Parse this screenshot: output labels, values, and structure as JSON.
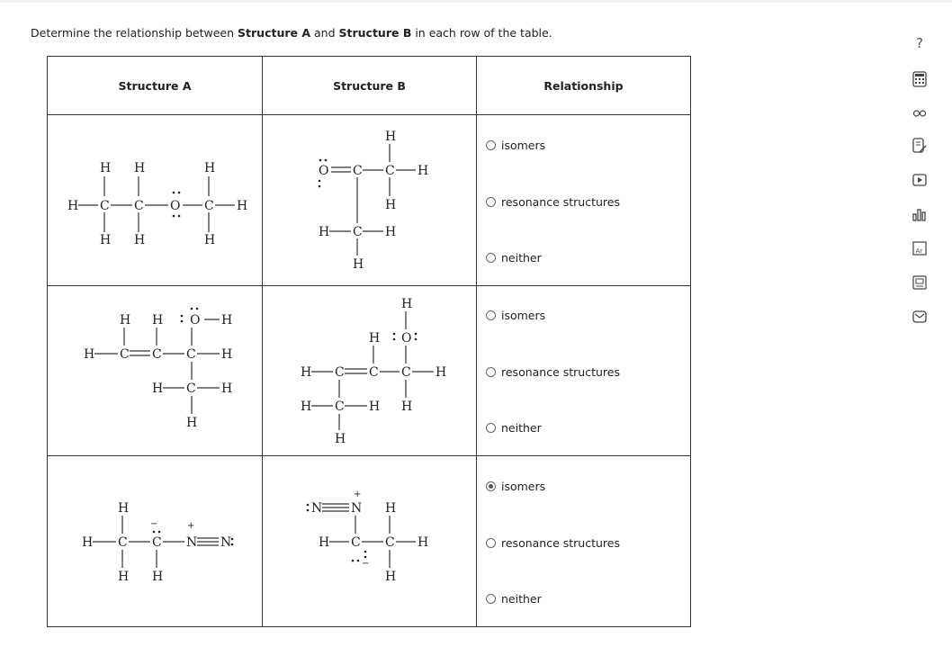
{
  "question": {
    "prefix": "Determine the relationship between ",
    "structure_a": "Structure A",
    "mid1": " and ",
    "structure_b": "Structure B",
    "suffix": " in each row of the table."
  },
  "table": {
    "headers": [
      "Structure A",
      "Structure B",
      "Relationship"
    ],
    "options": [
      "isomers",
      "resonance structures",
      "neither"
    ],
    "rows": [
      {
        "selected": null
      },
      {
        "selected": null
      },
      {
        "selected": "isomers"
      }
    ]
  },
  "sidebar": {
    "help_label": "?",
    "tools": [
      "calculator-icon",
      "glasses-icon",
      "reference-icon",
      "notes-icon",
      "video-icon",
      "chart-icon",
      "periodic-table-icon",
      "textbook-icon",
      "message-icon"
    ]
  },
  "atoms": {
    "H": "H",
    "C": "C",
    "O": "O",
    "N": "N",
    "dots2": ":",
    "plus": "+",
    "minus": "−",
    "Odots": "Ö",
    "Ndots": "N"
  }
}
